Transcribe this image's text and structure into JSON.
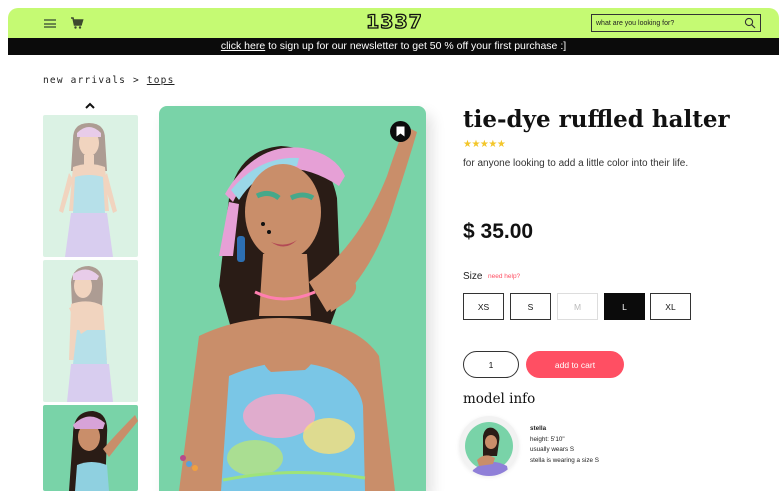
{
  "header": {
    "logo": "1337",
    "menu_icon": "hamburger-menu-icon",
    "cart_icon": "shopping-cart-icon",
    "search": {
      "placeholder": "what are you looking for?",
      "icon": "search-icon"
    },
    "background": "#c5fa73"
  },
  "banner": {
    "link_text": "click here",
    "text": " to sign up for our newsletter to get 50 % off your first purchase :]"
  },
  "breadcrumb": {
    "parent": "new arrivals",
    "separator": ">",
    "current": "tops"
  },
  "gallery": {
    "scroll_up_icon": "chevron-up-icon",
    "thumbnails": [
      "thumbnail-1",
      "thumbnail-2",
      "thumbnail-3"
    ],
    "bookmark_icon": "bookmark-icon",
    "image_background": "#79d3a8"
  },
  "product": {
    "title": "tie-dye ruffled halter",
    "stars": "★★★★★",
    "rating": 4.5,
    "description": "for anyone looking to add a little color into their life.",
    "price": "$ 35.00",
    "size_label": "Size",
    "size_help": "need help?",
    "sizes": [
      {
        "label": "XS",
        "state": "available"
      },
      {
        "label": "S",
        "state": "available"
      },
      {
        "label": "M",
        "state": "unavailable"
      },
      {
        "label": "L",
        "state": "selected"
      },
      {
        "label": "XL",
        "state": "available"
      }
    ],
    "quantity": "1",
    "add_to_cart": "add to cart",
    "accent_color": "#ff4f63"
  },
  "model_info": {
    "heading": "model info",
    "name": "stella",
    "height": "height: 5'10\"",
    "usual_size": "usually wears S",
    "wearing": "stella is wearing a size S"
  }
}
